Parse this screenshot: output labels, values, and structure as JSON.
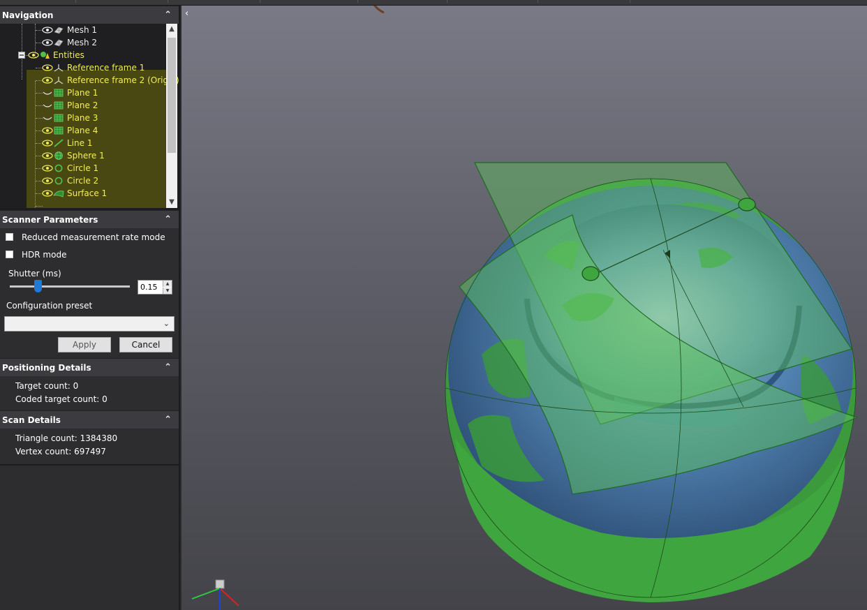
{
  "navigation": {
    "title": "Navigation",
    "items": [
      {
        "label": "Mesh 1",
        "kind": "mesh"
      },
      {
        "label": "Mesh 2",
        "kind": "mesh"
      },
      {
        "label": "Entities",
        "kind": "group"
      },
      {
        "label": "Reference frame 1",
        "kind": "frame"
      },
      {
        "label": "Reference frame 2 (Origin)",
        "kind": "frame"
      },
      {
        "label": "Plane 1",
        "kind": "plane"
      },
      {
        "label": "Plane 2",
        "kind": "plane"
      },
      {
        "label": "Plane 3",
        "kind": "plane"
      },
      {
        "label": "Plane 4",
        "kind": "plane"
      },
      {
        "label": "Line 1",
        "kind": "line"
      },
      {
        "label": "Sphere 1",
        "kind": "sphere"
      },
      {
        "label": "Circle 1",
        "kind": "circle"
      },
      {
        "label": "Circle 2",
        "kind": "circle"
      },
      {
        "label": "Surface 1",
        "kind": "surface"
      }
    ]
  },
  "scanner": {
    "title": "Scanner Parameters",
    "reduced_rate_label": "Reduced measurement rate mode",
    "hdr_label": "HDR mode",
    "shutter_label": "Shutter (ms)",
    "shutter_value": "0.15",
    "shutter_fraction": 0.23,
    "preset_label": "Configuration preset",
    "preset_value": "",
    "apply_label": "Apply",
    "cancel_label": "Cancel"
  },
  "positioning": {
    "title": "Positioning Details",
    "target_count": "Target count: 0",
    "coded_target_count": "Coded target count: 0"
  },
  "scan": {
    "title": "Scan Details",
    "triangle_count": "Triangle count: 1384380",
    "vertex_count": "Vertex count: 697497"
  },
  "colors": {
    "accent": "#1e7ad8",
    "entity_text": "#f2ee5a",
    "entity_highlight": "#4a4812",
    "mesh_blue": "#3d6f9e",
    "entity_green": "#3fa83f"
  }
}
